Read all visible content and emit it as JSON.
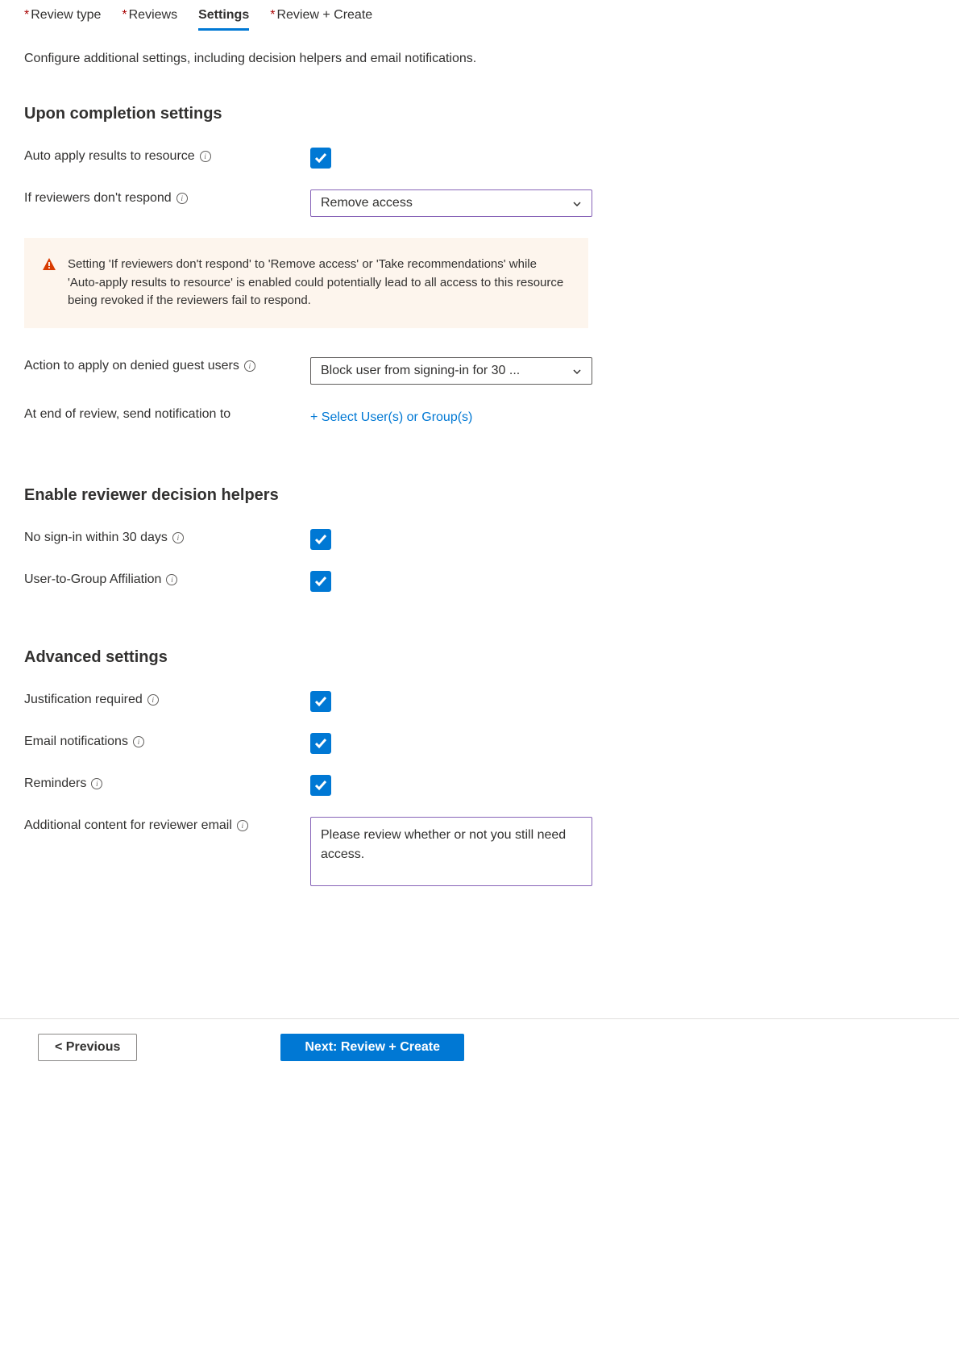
{
  "tabs": [
    {
      "label": "Review type",
      "required": true,
      "active": false
    },
    {
      "label": "Reviews",
      "required": true,
      "active": false
    },
    {
      "label": "Settings",
      "required": false,
      "active": true
    },
    {
      "label": "Review + Create",
      "required": true,
      "active": false
    }
  ],
  "description": "Configure additional settings, including decision helpers and email notifications.",
  "sections": {
    "completion": {
      "title": "Upon completion settings",
      "auto_apply_label": "Auto apply results to resource",
      "auto_apply_checked": true,
      "no_respond_label": "If reviewers don't respond",
      "no_respond_value": "Remove access",
      "warning_text": "Setting 'If reviewers don't respond' to 'Remove access' or 'Take recommendations' while 'Auto-apply results to resource' is enabled could potentially lead to all access to this resource being revoked if the reviewers fail to respond.",
      "denied_guest_label": "Action to apply on denied guest users",
      "denied_guest_value": "Block user from signing-in for 30 ...",
      "notify_label": "At end of review, send notification to",
      "notify_link": "+ Select User(s) or Group(s)"
    },
    "decision_helpers": {
      "title": "Enable reviewer decision helpers",
      "no_signin_label": "No sign-in within 30 days",
      "no_signin_checked": true,
      "affiliation_label": "User-to-Group Affiliation",
      "affiliation_checked": true
    },
    "advanced": {
      "title": "Advanced settings",
      "justification_label": "Justification required",
      "justification_checked": true,
      "email_label": "Email notifications",
      "email_checked": true,
      "reminders_label": "Reminders",
      "reminders_checked": true,
      "additional_content_label": "Additional content for reviewer email",
      "additional_content_value": "Please review whether or not you still need access."
    }
  },
  "footer": {
    "previous_label": "< Previous",
    "next_label": "Next: Review + Create"
  }
}
